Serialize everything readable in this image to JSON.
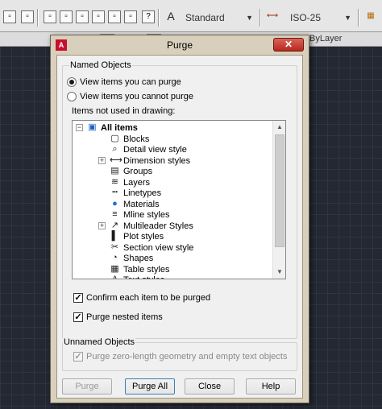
{
  "toolbar": {
    "text_style": "Standard",
    "dim_style": "ISO-25",
    "layer_value": "ByLayer"
  },
  "dialog": {
    "title": "Purge",
    "close_glyph": "✕"
  },
  "named_objects": {
    "label": "Named Objects",
    "option_view_can": "View items you can purge",
    "option_view_cannot": "View items you cannot purge",
    "selected_option": "View items you can purge",
    "list_label": "Items not used in drawing:"
  },
  "tree_items": [
    {
      "label": "All items",
      "icon": "drawing-icon",
      "expander": "⊟"
    },
    {
      "label": "Blocks",
      "icon": "block-icon",
      "expander": ""
    },
    {
      "label": "Detail view style",
      "icon": "detail-view-icon",
      "expander": ""
    },
    {
      "label": "Dimension styles",
      "icon": "dimension-icon",
      "expander": "⊞"
    },
    {
      "label": "Groups",
      "icon": "group-icon",
      "expander": ""
    },
    {
      "label": "Layers",
      "icon": "layers-icon",
      "expander": ""
    },
    {
      "label": "Linetypes",
      "icon": "linetype-icon",
      "expander": ""
    },
    {
      "label": "Materials",
      "icon": "material-icon",
      "expander": ""
    },
    {
      "label": "Mline styles",
      "icon": "mline-icon",
      "expander": ""
    },
    {
      "label": "Multileader Styles",
      "icon": "multileader-icon",
      "expander": "⊞"
    },
    {
      "label": "Plot styles",
      "icon": "plot-style-icon",
      "expander": ""
    },
    {
      "label": "Section view style",
      "icon": "section-view-icon",
      "expander": ""
    },
    {
      "label": "Shapes",
      "icon": "shape-icon",
      "expander": ""
    },
    {
      "label": "Table styles",
      "icon": "table-icon",
      "expander": ""
    },
    {
      "label": "Text styles",
      "icon": "text-style-icon",
      "expander": ""
    }
  ],
  "options": {
    "confirm_label": "Confirm each item to be purged",
    "nested_label": "Purge nested items"
  },
  "unnamed_objects": {
    "label": "Unnamed Objects",
    "zero_length_label": "Purge zero-length geometry and empty text objects"
  },
  "buttons": {
    "purge": "Purge",
    "purge_all": "Purge All",
    "close": "Close",
    "help": "Help"
  }
}
